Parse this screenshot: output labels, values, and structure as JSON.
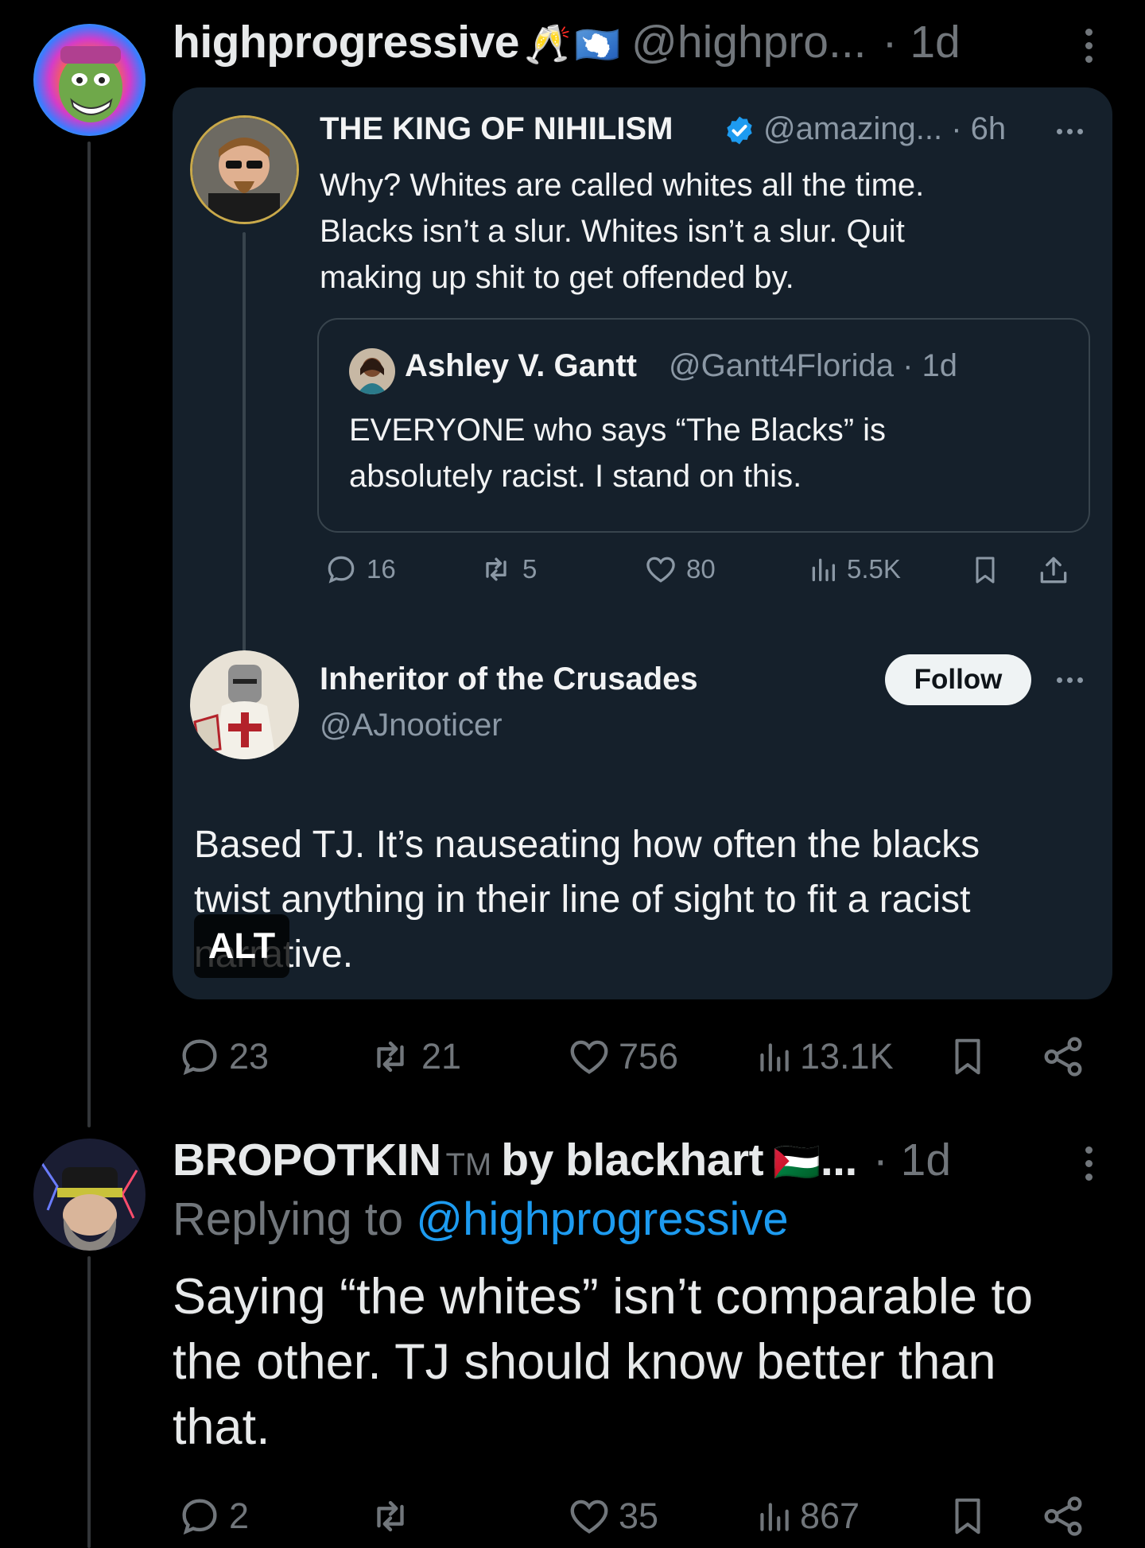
{
  "post1": {
    "display_name": "highprogressive",
    "emoji": [
      "🥂",
      "🇦🇶"
    ],
    "handle": "@highpro...",
    "time": "· 1d",
    "actions": {
      "replies": "23",
      "reposts": "21",
      "likes": "756",
      "views": "13.1K"
    }
  },
  "card": {
    "quoted": {
      "display_name": "THE KING OF NIHILISM",
      "handle_time": "@amazing... · 6h",
      "text_lines": [
        "Why? Whites are called whites all the time.",
        "Blacks isn’t a slur. Whites isn’t a slur. Quit",
        "making up shit to get offended by."
      ],
      "inner": {
        "display_name": "Ashley V. Gantt",
        "handle_time": "@Gantt4Florida · 1d",
        "text_lines": [
          "EVERYONE who says “The Blacks” is",
          "absolutely racist. I stand on this."
        ]
      },
      "actions": {
        "replies": "16",
        "reposts": "5",
        "likes": "80",
        "views": "5.5K"
      }
    },
    "reply": {
      "display_name": "Inheritor of the Crusades",
      "handle": "@AJnooticer",
      "follow_label": "Follow",
      "text_lines": [
        "Based TJ. It’s nauseating how often the blacks",
        "twist anything in their line of sight to fit a racist",
        "narrative."
      ]
    },
    "alt_label": "ALT"
  },
  "post2": {
    "display_name": "BROPOTKIN",
    "tm": "TM",
    "display_name_rest": "by blackhart",
    "flag": "🇵🇸",
    "ellipsis": "...",
    "time": "· 1d",
    "replying_prefix": "Replying to",
    "replying_handle": "@highprogressive",
    "text_lines": [
      "Saying “the whites” isn’t comparable to",
      "the other. TJ should know better than",
      "that."
    ],
    "actions": {
      "replies": "2",
      "reposts": "",
      "likes": "35",
      "views": "867"
    }
  },
  "colors": {
    "background": "#000000",
    "card": "#15202b",
    "link": "#1d9bf0",
    "muted": "#71767b"
  },
  "icons": [
    "reply-icon",
    "repost-icon",
    "like-icon",
    "views-icon",
    "bookmark-icon",
    "share-icon",
    "more-icon",
    "verified-icon"
  ]
}
